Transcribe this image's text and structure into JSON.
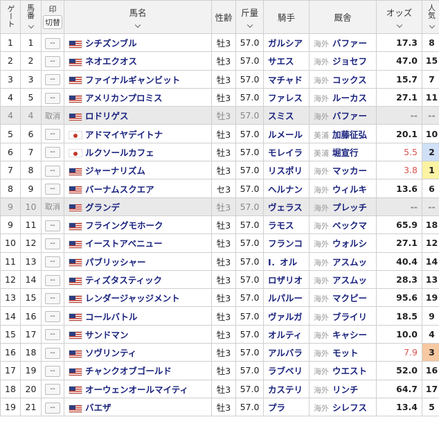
{
  "header": {
    "gate": "ゲート",
    "num_line1": "馬",
    "num_line2": "番",
    "mark": "印",
    "mark_toggle": "切替",
    "horse": "馬名",
    "sexage": "性齢",
    "weight": "斤量",
    "jockey": "騎手",
    "trainer": "厩舎",
    "odds": "オッズ",
    "pop_line1": "人",
    "pop_line2": "気"
  },
  "colors": {
    "pop1": "#fdf3a3",
    "pop2": "#cfe0f7",
    "pop3": "#f6c9a2",
    "hot_odds": "#d9534f"
  },
  "rows": [
    {
      "gate": "1",
      "num": "1",
      "mark": "--",
      "flag": "us",
      "horse": "シチズンブル",
      "sexage": "牡3",
      "weight": "57.0",
      "jockey": "ガルシア",
      "region": "海外",
      "trainer": "バファー",
      "odds": "17.3",
      "pop": "8"
    },
    {
      "gate": "2",
      "num": "2",
      "mark": "--",
      "flag": "us",
      "horse": "ネオエクオス",
      "sexage": "牡3",
      "weight": "57.0",
      "jockey": "サエス",
      "region": "海外",
      "trainer": "ジョセフ",
      "odds": "47.0",
      "pop": "15"
    },
    {
      "gate": "3",
      "num": "3",
      "mark": "--",
      "flag": "us",
      "horse": "ファイナルギャンビット",
      "sexage": "牡3",
      "weight": "57.0",
      "jockey": "マチャド",
      "region": "海外",
      "trainer": "コックス",
      "odds": "15.7",
      "pop": "7"
    },
    {
      "gate": "4",
      "num": "5",
      "mark": "--",
      "flag": "us",
      "horse": "アメリカンプロミス",
      "sexage": "牡3",
      "weight": "57.0",
      "jockey": "ファレス",
      "region": "海外",
      "trainer": "ルーカス",
      "odds": "27.1",
      "pop": "11"
    },
    {
      "gate": "4",
      "num": "4",
      "mark": "取消",
      "flag": "us",
      "horse": "ロドリゲス",
      "sexage": "牡3",
      "weight": "57.0",
      "jockey": "スミス",
      "region": "海外",
      "trainer": "バファー",
      "odds": "--",
      "pop": "--",
      "scratched": true
    },
    {
      "gate": "5",
      "num": "6",
      "mark": "--",
      "flag": "jp",
      "horse": "アドマイヤデイトナ",
      "sexage": "牡3",
      "weight": "57.0",
      "jockey": "ルメール",
      "region": "美浦",
      "trainer": "加藤征弘",
      "odds": "20.1",
      "pop": "10"
    },
    {
      "gate": "6",
      "num": "7",
      "mark": "--",
      "flag": "jp",
      "horse": "ルクソールカフェ",
      "sexage": "牡3",
      "weight": "57.0",
      "jockey": "モレイラ",
      "region": "美浦",
      "trainer": "堀宣行",
      "odds": "5.5",
      "pop": "2",
      "hot": true,
      "popcolor": "pop2"
    },
    {
      "gate": "7",
      "num": "8",
      "mark": "--",
      "flag": "us",
      "horse": "ジャーナリズム",
      "sexage": "牡3",
      "weight": "57.0",
      "jockey": "リスポリ",
      "region": "海外",
      "trainer": "マッカー",
      "odds": "3.8",
      "pop": "1",
      "hot": true,
      "popcolor": "pop1"
    },
    {
      "gate": "8",
      "num": "9",
      "mark": "--",
      "flag": "us",
      "horse": "バーナムスクエア",
      "sexage": "セ3",
      "weight": "57.0",
      "jockey": "ヘルナン",
      "region": "海外",
      "trainer": "ウィルキ",
      "odds": "13.6",
      "pop": "6"
    },
    {
      "gate": "9",
      "num": "10",
      "mark": "取消",
      "flag": "us",
      "horse": "グランデ",
      "sexage": "牡3",
      "weight": "57.0",
      "jockey": "ヴェラス",
      "region": "海外",
      "trainer": "プレッチ",
      "odds": "--",
      "pop": "--",
      "scratched": true
    },
    {
      "gate": "9",
      "num": "11",
      "mark": "--",
      "flag": "us",
      "horse": "フライングモホーク",
      "sexage": "牡3",
      "weight": "57.0",
      "jockey": "ラモス",
      "region": "海外",
      "trainer": "ベックマ",
      "odds": "65.9",
      "pop": "18"
    },
    {
      "gate": "10",
      "num": "12",
      "mark": "--",
      "flag": "us",
      "horse": "イーストアベニュー",
      "sexage": "牡3",
      "weight": "57.0",
      "jockey": "フランコ",
      "region": "海外",
      "trainer": "ウォルシ",
      "odds": "27.1",
      "pop": "12"
    },
    {
      "gate": "11",
      "num": "13",
      "mark": "--",
      "flag": "us",
      "horse": "パブリッシャー",
      "sexage": "牡3",
      "weight": "57.0",
      "jockey": "I．オル",
      "region": "海外",
      "trainer": "アスムッ",
      "odds": "40.4",
      "pop": "14"
    },
    {
      "gate": "12",
      "num": "14",
      "mark": "--",
      "flag": "us",
      "horse": "ティズタスティック",
      "sexage": "牡3",
      "weight": "57.0",
      "jockey": "ロザリオ",
      "region": "海外",
      "trainer": "アスムッ",
      "odds": "28.3",
      "pop": "13"
    },
    {
      "gate": "13",
      "num": "15",
      "mark": "--",
      "flag": "us",
      "horse": "レンダージャッジメント",
      "sexage": "牡3",
      "weight": "57.0",
      "jockey": "ルパルー",
      "region": "海外",
      "trainer": "マクピー",
      "odds": "95.6",
      "pop": "19"
    },
    {
      "gate": "14",
      "num": "16",
      "mark": "--",
      "flag": "us",
      "horse": "コールバトル",
      "sexage": "牡3",
      "weight": "57.0",
      "jockey": "ヴァルガ",
      "region": "海外",
      "trainer": "ブライリ",
      "odds": "18.5",
      "pop": "9"
    },
    {
      "gate": "15",
      "num": "17",
      "mark": "--",
      "flag": "us",
      "horse": "サンドマン",
      "sexage": "牡3",
      "weight": "57.0",
      "jockey": "オルティ",
      "region": "海外",
      "trainer": "キャシー",
      "odds": "10.0",
      "pop": "4"
    },
    {
      "gate": "16",
      "num": "18",
      "mark": "--",
      "flag": "us",
      "horse": "ソヴリンティ",
      "sexage": "牡3",
      "weight": "57.0",
      "jockey": "アルバラ",
      "region": "海外",
      "trainer": "モット",
      "odds": "7.9",
      "pop": "3",
      "hot": true,
      "popcolor": "pop3"
    },
    {
      "gate": "17",
      "num": "19",
      "mark": "--",
      "flag": "us",
      "horse": "チャンクオブゴールド",
      "sexage": "牡3",
      "weight": "57.0",
      "jockey": "ラブベリ",
      "region": "海外",
      "trainer": "ウエスト",
      "odds": "52.0",
      "pop": "16"
    },
    {
      "gate": "18",
      "num": "20",
      "mark": "--",
      "flag": "us",
      "horse": "オーウェンオールマイティ",
      "sexage": "牡3",
      "weight": "57.0",
      "jockey": "カステリ",
      "region": "海外",
      "trainer": "リンチ",
      "odds": "64.7",
      "pop": "17"
    },
    {
      "gate": "19",
      "num": "21",
      "mark": "--",
      "flag": "us",
      "horse": "バエザ",
      "sexage": "牡3",
      "weight": "57.0",
      "jockey": "プラ",
      "region": "海外",
      "trainer": "シレフス",
      "odds": "13.4",
      "pop": "5"
    }
  ]
}
